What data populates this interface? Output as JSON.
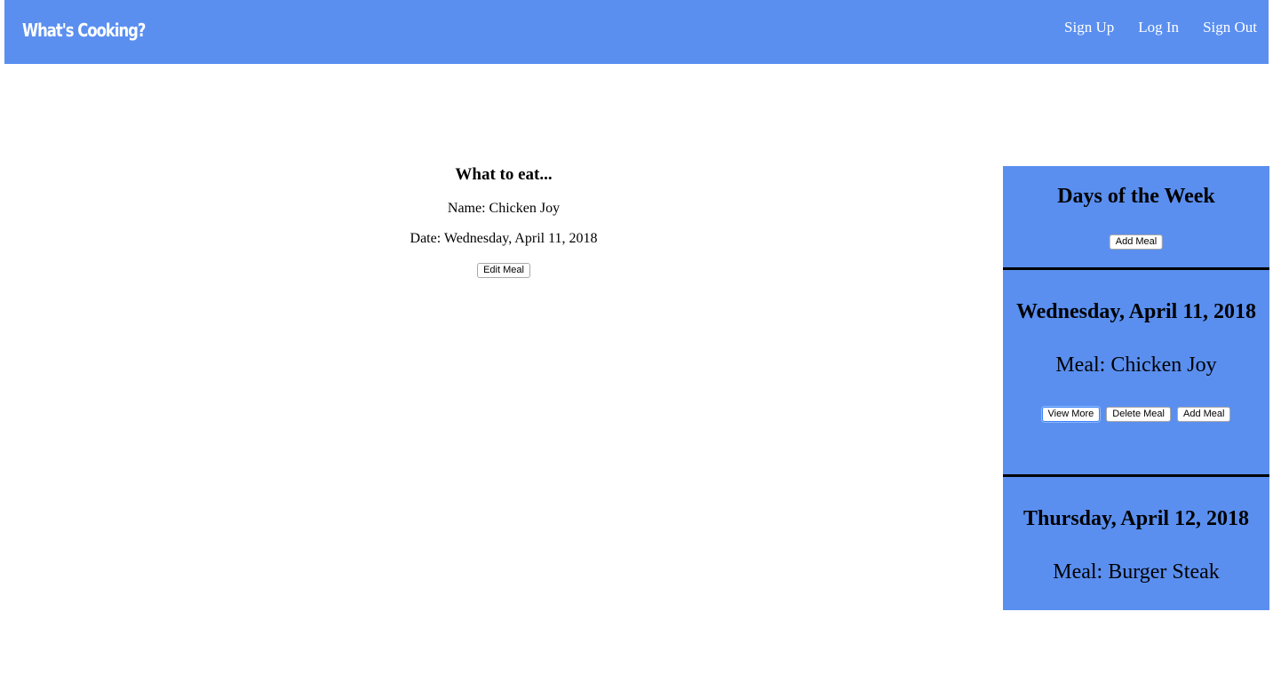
{
  "header": {
    "brand": "What's Cooking?",
    "links": [
      "Sign Up",
      "Log In",
      "Sign Out"
    ]
  },
  "detail": {
    "heading": "What to eat...",
    "name_line": "Name: Chicken Joy",
    "date_line": "Date: Wednesday, April 11, 2018",
    "edit_button": "Edit Meal"
  },
  "sidebar": {
    "title": "Days of the Week",
    "add_button": "Add Meal",
    "days": [
      {
        "date": "Wednesday, April 11, 2018",
        "meal": "Meal: Chicken Joy",
        "buttons": [
          "View More",
          "Delete Meal",
          "Add Meal"
        ]
      },
      {
        "date": "Thursday, April 12, 2018",
        "meal": "Meal: Burger Steak"
      }
    ]
  },
  "colors": {
    "accent": "#5a8ff0",
    "text_light": "#ffffff",
    "divider": "#000000"
  }
}
